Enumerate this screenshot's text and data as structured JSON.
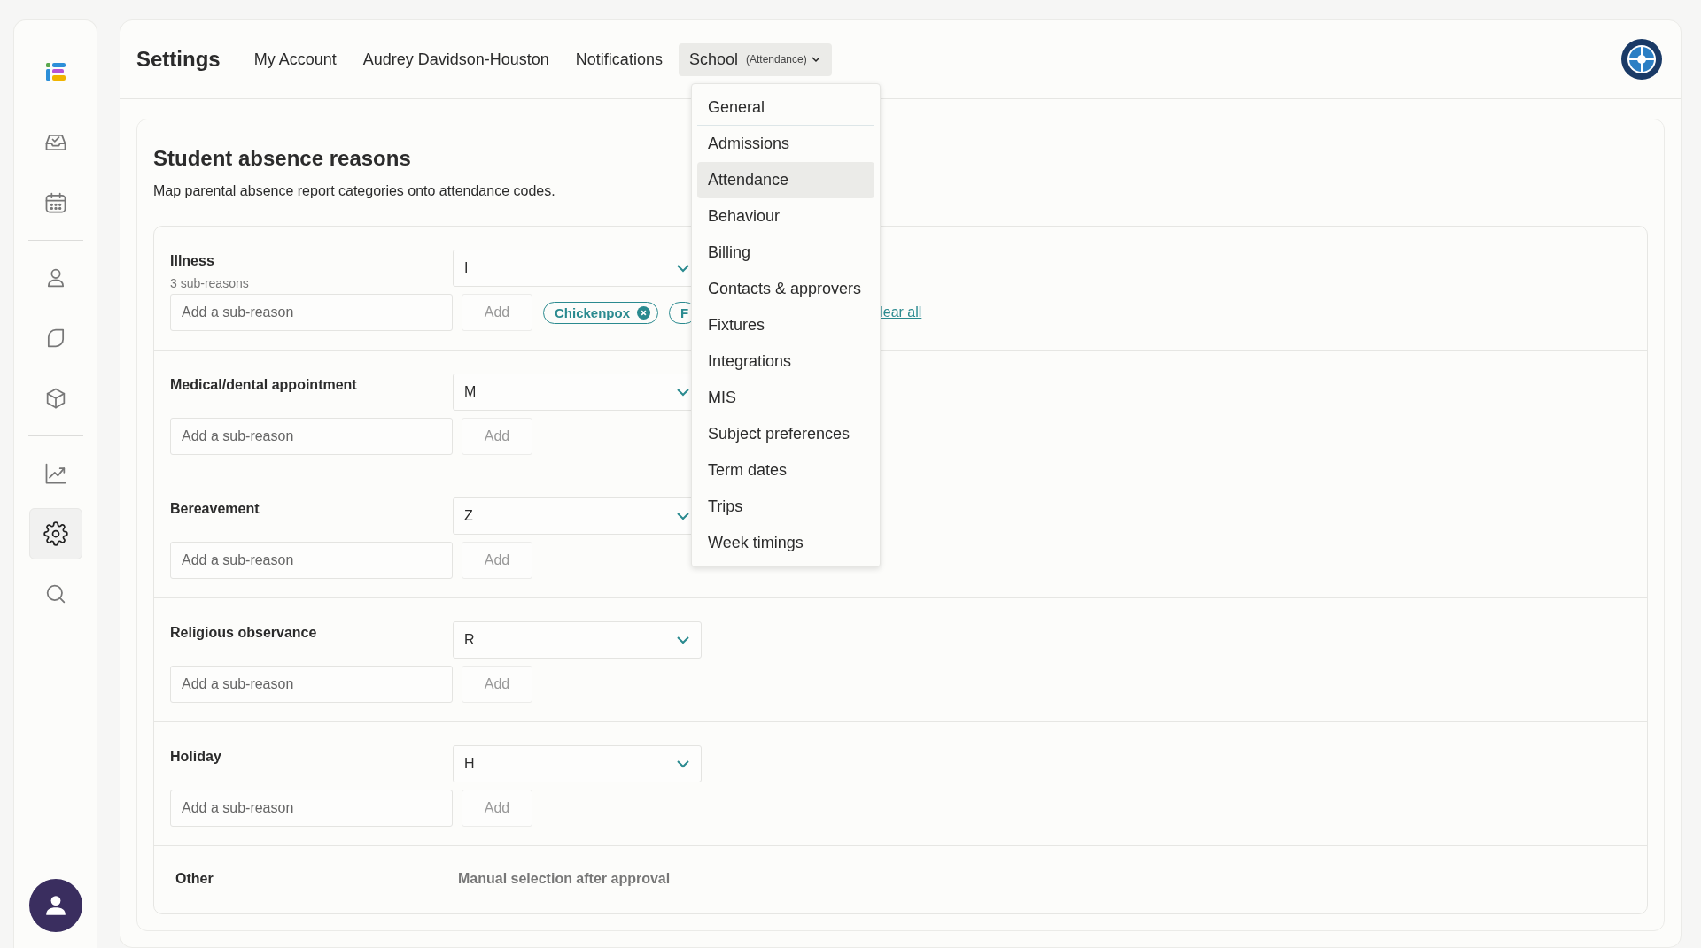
{
  "sidebar": {
    "groups": [
      {
        "items": [
          {
            "kind": "inbox",
            "selected": false
          },
          {
            "kind": "calendar",
            "selected": false
          }
        ]
      },
      {
        "items": [
          {
            "kind": "person",
            "selected": false
          },
          {
            "kind": "leaf",
            "selected": false
          },
          {
            "kind": "cube",
            "selected": false
          }
        ]
      },
      {
        "items": [
          {
            "kind": "chart",
            "selected": false
          },
          {
            "kind": "gear",
            "selected": true
          },
          {
            "kind": "search",
            "selected": false
          }
        ]
      }
    ]
  },
  "header": {
    "title": "Settings",
    "tabs": [
      {
        "label": "My Account",
        "selected": false
      },
      {
        "label": "Audrey Davidson-Houston",
        "selected": false
      },
      {
        "label": "Notifications",
        "selected": false
      },
      {
        "label": "School",
        "sub": "(Attendance)",
        "selected": true
      }
    ]
  },
  "menu": {
    "items": [
      {
        "label": "General",
        "selected": false
      },
      {
        "label": "Admissions",
        "selected": false
      },
      {
        "label": "Attendance",
        "selected": true
      },
      {
        "label": "Behaviour",
        "selected": false
      },
      {
        "label": "Billing",
        "selected": false
      },
      {
        "label": "Contacts & approvers",
        "selected": false
      },
      {
        "label": "Fixtures",
        "selected": false
      },
      {
        "label": "Integrations",
        "selected": false
      },
      {
        "label": "MIS",
        "selected": false
      },
      {
        "label": "Subject preferences",
        "selected": false
      },
      {
        "label": "Term dates",
        "selected": false
      },
      {
        "label": "Trips",
        "selected": false
      },
      {
        "label": "Week timings",
        "selected": false
      }
    ]
  },
  "section": {
    "title": "Student absence reasons",
    "description": "Map parental absence report categories onto attendance codes.",
    "reasons": [
      {
        "kind": "mapped",
        "name": "Illness",
        "count": "3 sub-reasons",
        "code": "I",
        "placeholder": "Add a sub-reason",
        "add": "Add",
        "chips": [
          "Chickenpox",
          "F"
        ],
        "clear": "lear all"
      },
      {
        "kind": "mapped",
        "name": "Medical/dental appointment",
        "code": "M",
        "placeholder": "Add a sub-reason",
        "add": "Add"
      },
      {
        "kind": "mapped",
        "name": "Bereavement",
        "code": "Z",
        "placeholder": "Add a sub-reason",
        "add": "Add"
      },
      {
        "kind": "mapped",
        "name": "Religious observance",
        "code": "R",
        "placeholder": "Add a sub-reason",
        "add": "Add"
      },
      {
        "kind": "mapped",
        "name": "Holiday",
        "code": "H",
        "placeholder": "Add a sub-reason",
        "add": "Add"
      },
      {
        "kind": "manual",
        "name": "Other",
        "note": "Manual selection after approval"
      }
    ]
  }
}
